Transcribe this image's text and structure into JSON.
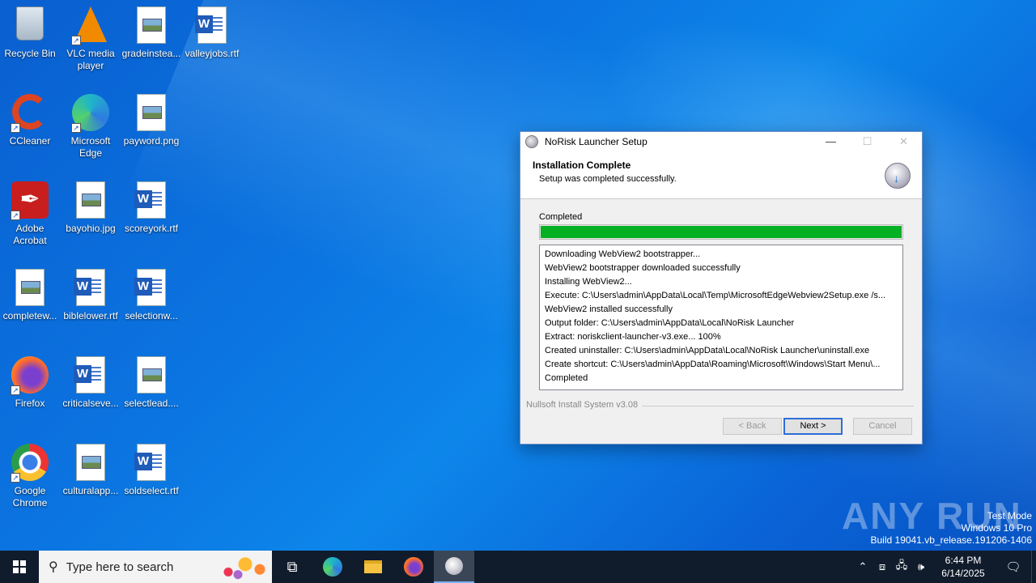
{
  "desktop": {
    "icons": [
      {
        "label": "Recycle Bin",
        "icon": "recycle-bin-icon"
      },
      {
        "label": "VLC media player",
        "icon": "vlc-icon"
      },
      {
        "label": "gradeinstea...",
        "icon": "image-file-icon"
      },
      {
        "label": "valleyjobs.rtf",
        "icon": "word-document-icon"
      },
      {
        "label": "CCleaner",
        "icon": "ccleaner-icon"
      },
      {
        "label": "Microsoft Edge",
        "icon": "edge-icon"
      },
      {
        "label": "payword.png",
        "icon": "image-file-icon"
      },
      {
        "label": "Adobe Acrobat",
        "icon": "acrobat-icon"
      },
      {
        "label": "bayohio.jpg",
        "icon": "image-file-icon"
      },
      {
        "label": "scoreyork.rtf",
        "icon": "word-document-icon"
      },
      {
        "label": "completew...",
        "icon": "image-file-icon"
      },
      {
        "label": "biblelower.rtf",
        "icon": "word-document-icon"
      },
      {
        "label": "selectionw...",
        "icon": "word-document-icon"
      },
      {
        "label": "Firefox",
        "icon": "firefox-icon"
      },
      {
        "label": "criticalseve...",
        "icon": "word-document-icon"
      },
      {
        "label": "selectlead....",
        "icon": "image-file-icon"
      },
      {
        "label": "Google Chrome",
        "icon": "chrome-icon"
      },
      {
        "label": "culturalapp...",
        "icon": "image-file-icon"
      },
      {
        "label": "soldselect.rtf",
        "icon": "word-document-icon"
      }
    ]
  },
  "window": {
    "title": "NoRisk Launcher Setup",
    "header_title": "Installation Complete",
    "header_subtitle": "Setup was completed successfully.",
    "progress_label": "Completed",
    "progress_value": 1.0,
    "log": [
      "Downloading WebView2 bootstrapper...",
      "WebView2 bootstrapper downloaded successfully",
      "Installing WebView2...",
      "Execute: C:\\Users\\admin\\AppData\\Local\\Temp\\MicrosoftEdgeWebview2Setup.exe /s...",
      "WebView2 installed successfully",
      "Output folder: C:\\Users\\admin\\AppData\\Local\\NoRisk Launcher",
      "Extract: noriskclient-launcher-v3.exe... 100%",
      "Created uninstaller: C:\\Users\\admin\\AppData\\Local\\NoRisk Launcher\\uninstall.exe",
      "Create shortcut: C:\\Users\\admin\\AppData\\Roaming\\Microsoft\\Windows\\Start Menu\\...",
      "Completed"
    ],
    "branding": "Nullsoft Install System v3.08",
    "back_label": "< Back",
    "next_label": "Next >",
    "cancel_label": "Cancel",
    "progress_color": "#06b025"
  },
  "watermark": {
    "brand": "ANY RUN",
    "line1": "Test Mode",
    "line2": "Windows 10 Pro",
    "line3": "Build 19041.vb_release.191206-1406"
  },
  "taskbar": {
    "search_placeholder": "Type here to search",
    "time": "6:44 PM",
    "date": "6/14/2025"
  }
}
